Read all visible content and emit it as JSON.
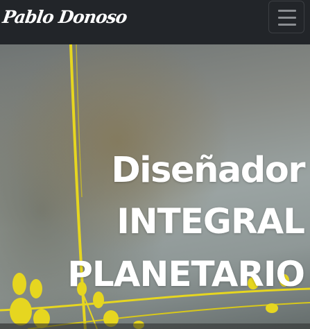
{
  "navbar": {
    "brand": "Pablo Donoso",
    "toggler_icon": "hamburger-menu-icon"
  },
  "hero": {
    "line1": "Diseñador",
    "line2": "INTEGRAL",
    "line3": "PLANETARIO",
    "accent_color": "#e6d620",
    "text_color": "#ffffff"
  }
}
